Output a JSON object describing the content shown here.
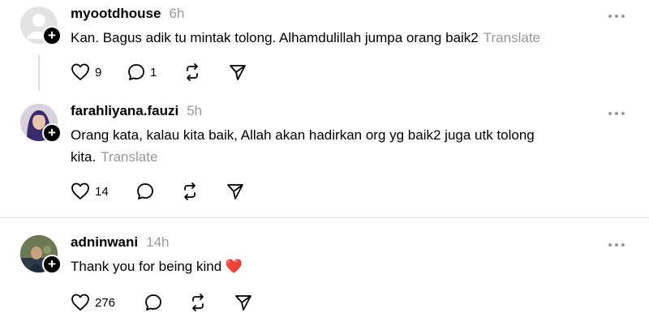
{
  "posts": [
    {
      "username": "myootdhouse",
      "time": "6h",
      "text": "Kan. Bagus adik tu mintak tolong. Alhamdulillah jumpa orang baik2",
      "translate": "Translate",
      "likes": "9",
      "replies": "1",
      "avatar": "default-avatar"
    },
    {
      "username": "farahliyana.fauzi",
      "time": "5h",
      "text": "Orang kata, kalau kita baik, Allah akan hadirkan org yg baik2 juga utk tolong kita.",
      "translate": "Translate",
      "likes": "14",
      "avatar": "hijab-avatar"
    },
    {
      "username": "adninwani",
      "time": "14h",
      "text": "Thank you for being kind ❤️",
      "likes": "276",
      "avatar": "photo-avatar"
    }
  ],
  "icons": {
    "like": "heart-icon",
    "reply": "comment-icon",
    "repost": "repost-icon",
    "share": "send-icon",
    "more": "more-icon",
    "follow": "plus-icon"
  },
  "colors": {
    "muted": "#999999",
    "line": "#dddddd",
    "heart": "#e0245e"
  }
}
